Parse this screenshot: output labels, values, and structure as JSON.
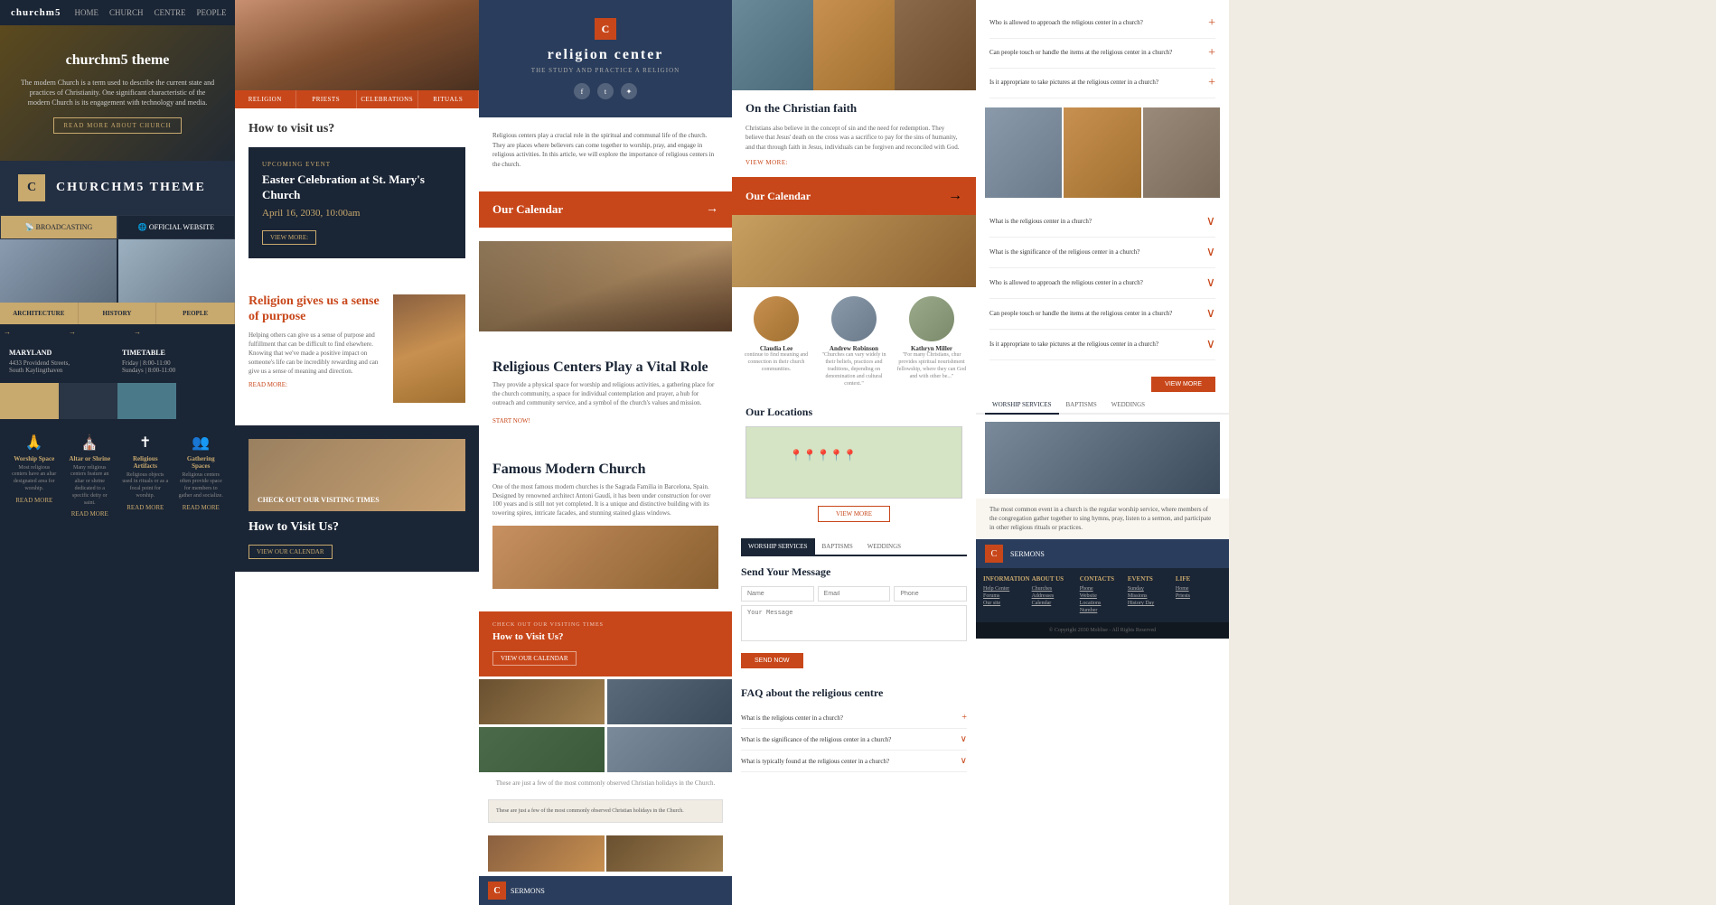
{
  "panel1": {
    "nav": {
      "logo": "churchm5",
      "items": [
        "HOME",
        "CHURCH",
        "CENTRE",
        "PEOPLE"
      ]
    },
    "hero": {
      "title": "churchm5 theme",
      "description": "The modern Church is a term used to describe the current state and practices of Christianity. One significant characteristic of the modern Church is its engagement with technology and media.",
      "cta": "READ MORE ABOUT CHURCH"
    },
    "logo_section": {
      "letter": "C",
      "title": "CHURCHM5 THEME"
    },
    "broadcast": {
      "item1": "BROADCASTING",
      "item2": "OFFICIAL WEBSITE"
    },
    "nav_items": [
      "ARCHITECTURE",
      "HISTORY",
      "PEOPLE"
    ],
    "info": {
      "location": {
        "label": "MARYLAND",
        "address": "4433 Providend Streets,",
        "city": "South Kaylingthaven"
      },
      "timetable": {
        "label": "TIMETABLE",
        "friday": "Friday | 8:00-11:00",
        "sunday": "Sundays | 8:00-11:00"
      }
    },
    "features": [
      {
        "icon": "🙏",
        "title": "Worship Space",
        "description": "Most religious centers have an altar designated area for worship."
      },
      {
        "icon": "⛪",
        "title": "Altar or Shrine",
        "description": "Many religious centers feature an altar or shrine dedicated to a specific deity or saint."
      },
      {
        "icon": "✝",
        "title": "Religious Artifacts",
        "description": "Religious objects used in rituals or as a focal point for worship."
      },
      {
        "icon": "👥",
        "title": "Gathering Spaces",
        "description": "Religious centers often provide space for members to gather and socialize."
      }
    ],
    "read_more": "READ MORE"
  },
  "panel2": {
    "tabs": [
      "RELIGION",
      "PRIESTS",
      "CELEBRATIONS",
      "RITUALS"
    ],
    "how_to_visit": "How to visit us?",
    "event": {
      "label": "UPCOMING EVENT",
      "title": "Easter Celebration at St. Mary's Church",
      "date": "April 16, 2030, 10:00am",
      "cta": "VIEW MORE:"
    },
    "religion_section": {
      "title": "Religion gives us a sense of purpose",
      "description": "Helping others can give us a sense of purpose and fulfillment that can be difficult to find elsewhere. Knowing that we've made a positive impact on someone's life can be incredibly rewarding and can give us a sense of meaning and direction.",
      "read_more": "READ MORE:"
    },
    "visit_section": {
      "title": "How to Visit Us?",
      "cta": "VIEW OUR CALENDAR"
    }
  },
  "panel3": {
    "header": {
      "letter": "C",
      "title": "religion center",
      "subtitle": "THE STUDY AND PRACTICE A RELIGION"
    },
    "intro": "Religious centers play a crucial role in the spiritual and communal life of the church. They are places where believers can come together to worship, pray, and engage in religious activities. In this article, we will explore the importance of religious centers in the church.",
    "calendar": {
      "title": "Our Calendar",
      "arrow": "→"
    },
    "vital_section": {
      "title": "Religious Centers Play a Vital Role",
      "description": "They provide a physical space for worship and religious activities, a gathering place for the church community, a space for individual contemplation and prayer, a hub for outreach and community service, and a symbol of the church's values and mission."
    },
    "famous_section": {
      "title": "Famous Modern Church",
      "description": "One of the most famous modern churches is the Sagrada Familia in Barcelona, Spain. Designed by renowned architect Antoni Gaudí, it has been under construction for over 100 years and is still not yet completed. It is a unique and distinctive building with its towering spires, intricate facades, and stunning stained glass windows."
    },
    "visit_times": {
      "label": "CHECK OUT OUR VISITING TIMES",
      "title": "How to Visit Us?",
      "cta": "VIEW OUR CALENDAR"
    },
    "caption": "These are just a few of the most commonly observed Christian holidays in the Church."
  },
  "panel4": {
    "christian_faith": {
      "title": "On the Christian faith",
      "description": "Christians also believe in the concept of sin and the need for redemption. They believe that Jesus' death on the cross was a sacrifice to pay for the sins of humanity, and that through faith in Jesus, individuals can be forgiven and reconciled with God.",
      "view_more": "VIEW MORE:"
    },
    "calendar": {
      "title": "Our Calendar",
      "arrow": "→"
    },
    "people": [
      {
        "name": "Claudia Lee",
        "quote": "continue to find meaning and connection in their church communities."
      },
      {
        "name": "Andrew Robinson",
        "quote": "\"Churches can vary widely in their beliefs, practices and traditions, depending on denomination and cultural context.\""
      },
      {
        "name": "Kathryn Miller",
        "quote": "\"For many Christians, chur provides spiritual nourishment fellowship, where they can God and with other be...\""
      }
    ],
    "locations": {
      "title": "Our Locations",
      "view_more": "VIEW MORE"
    },
    "tabs": [
      "WORSHIP SERVICES",
      "BAPTISMS",
      "WEDDINGS"
    ],
    "form": {
      "title": "Send Your Message",
      "name_placeholder": "Name",
      "email_placeholder": "Email",
      "phone_placeholder": "Phone",
      "message_placeholder": "Your Message",
      "send_btn": "SEND NOW"
    },
    "faq": {
      "title": "FAQ about the religious centre",
      "items": [
        {
          "question": "What is the religious center in a church?",
          "open": true
        },
        {
          "question": "What is the significance of the religious center in a church?",
          "open": false
        },
        {
          "question": "What is typically found at the religious center in a church?",
          "open": false
        }
      ]
    }
  },
  "panel5": {
    "faq_items": [
      {
        "question": "Who is allowed to approach the religious center in a church?",
        "open": false
      },
      {
        "question": "Can people touch or handle the items at the religious center in a church?",
        "open": false
      },
      {
        "question": "Is it appropriate to take pictures at the religious center in a church?",
        "open": false
      },
      {
        "question": "What is the religious center in a church?",
        "open": true
      },
      {
        "question": "What is the significance of the religious center in a church?",
        "open": false
      },
      {
        "question": "Who is allowed to approach the religious center in a church?",
        "open": false
      },
      {
        "question": "Can people touch or handle the items at the religious center in a church?",
        "open": false
      },
      {
        "question": "Is it appropriate to take pictures at the religious center in a church?",
        "open": false
      }
    ],
    "worship_tab": "WORSHIP SERVICES",
    "baptisms_tab": "BAPTISMS",
    "weddings_tab": "WEDDINGS",
    "testimonial": "The most common event in a church is the regular worship service, where members of the congregation gather together to sing hymns, pray, listen to a sermon, and participate in other religious rituals or practices.",
    "footer": {
      "columns": [
        {
          "title": "INFORMATION",
          "links": [
            "Help Center",
            "Forums",
            "Our site"
          ]
        },
        {
          "title": "ABOUT US",
          "links": [
            "Churches",
            "Addresses",
            "Calendar"
          ]
        },
        {
          "title": "CONTACTS",
          "links": [
            "Phone",
            "Website",
            "Locations",
            "Number"
          ]
        },
        {
          "title": "EVENTS",
          "links": [
            "Sunday",
            "Missions",
            "History Day"
          ]
        },
        {
          "title": "Life",
          "links": [
            "Home",
            "Priests"
          ]
        }
      ],
      "copyright": "© Copyright 2030 Moblise - All Rights Reserved"
    }
  }
}
